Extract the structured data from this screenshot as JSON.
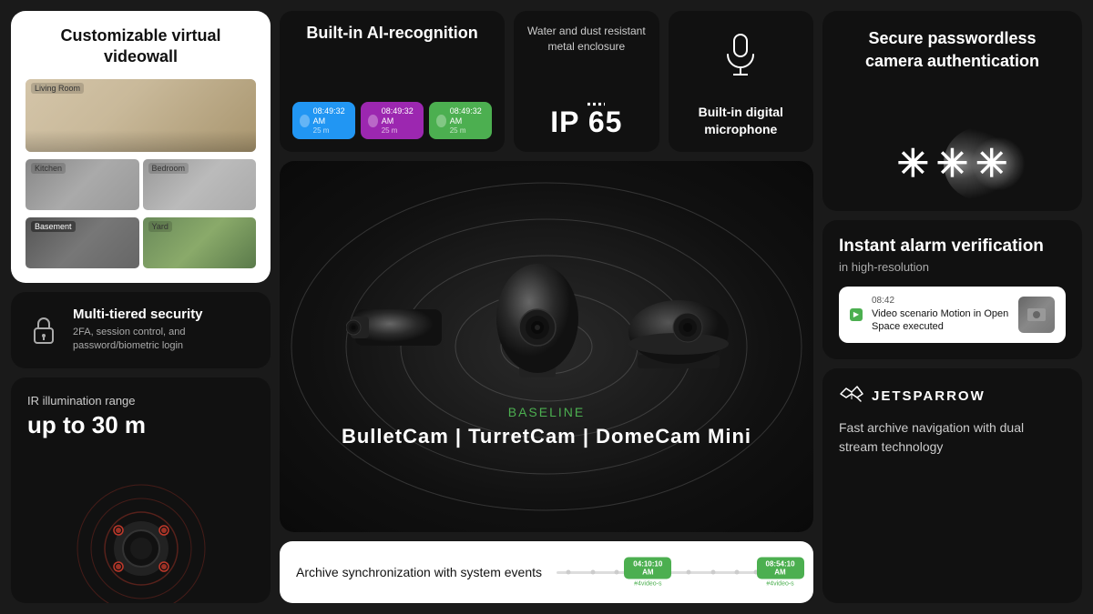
{
  "left": {
    "videowall": {
      "title": "Customizable virtual videowall",
      "rooms": [
        "Living Room",
        "Kitchen",
        "Bedroom",
        "Basement",
        "Yard"
      ]
    },
    "security": {
      "title": "Multi-tiered security",
      "description": "2FA, session control, and password/biometric login"
    },
    "ir": {
      "label": "IR illumination range",
      "range": "up to 30 m"
    }
  },
  "center": {
    "features": {
      "ai": {
        "title": "Built-in AI-recognition",
        "badges": [
          {
            "time": "08:49:32 AM",
            "dist": "25 m",
            "color": "blue"
          },
          {
            "time": "08:49:32 AM",
            "dist": "25 m",
            "color": "purple"
          },
          {
            "time": "08:49:32 AM",
            "dist": "25 m",
            "color": "green"
          }
        ]
      },
      "ip65": {
        "label": "Water and dust resistant metal enclosure",
        "badge": "IP 65"
      },
      "mic": {
        "title": "Built-in digital microphone"
      }
    },
    "brand": "BASELINE",
    "brand_letter": "B",
    "models": "BulletCam  |  TurretCam  |  DomeCam Mini",
    "archive": {
      "label": "Archive synchronization with system events",
      "events": [
        {
          "time": "04:10:10 AM",
          "label": "#4video-s"
        },
        {
          "time": "08:54:10 AM",
          "label": "#4video-s"
        }
      ]
    }
  },
  "right": {
    "passwordless": {
      "title": "Secure passwordless camera authentication",
      "asterisks": "***"
    },
    "alarm": {
      "title": "Instant alarm verification",
      "subtitle": "in high-resolution",
      "notification": {
        "time": "08:42",
        "text": "Video scenario Motion in Open Space executed"
      }
    },
    "jetsparrow": {
      "logo": "JETSPARROW",
      "description": "Fast archive navigation with dual stream technology"
    }
  }
}
